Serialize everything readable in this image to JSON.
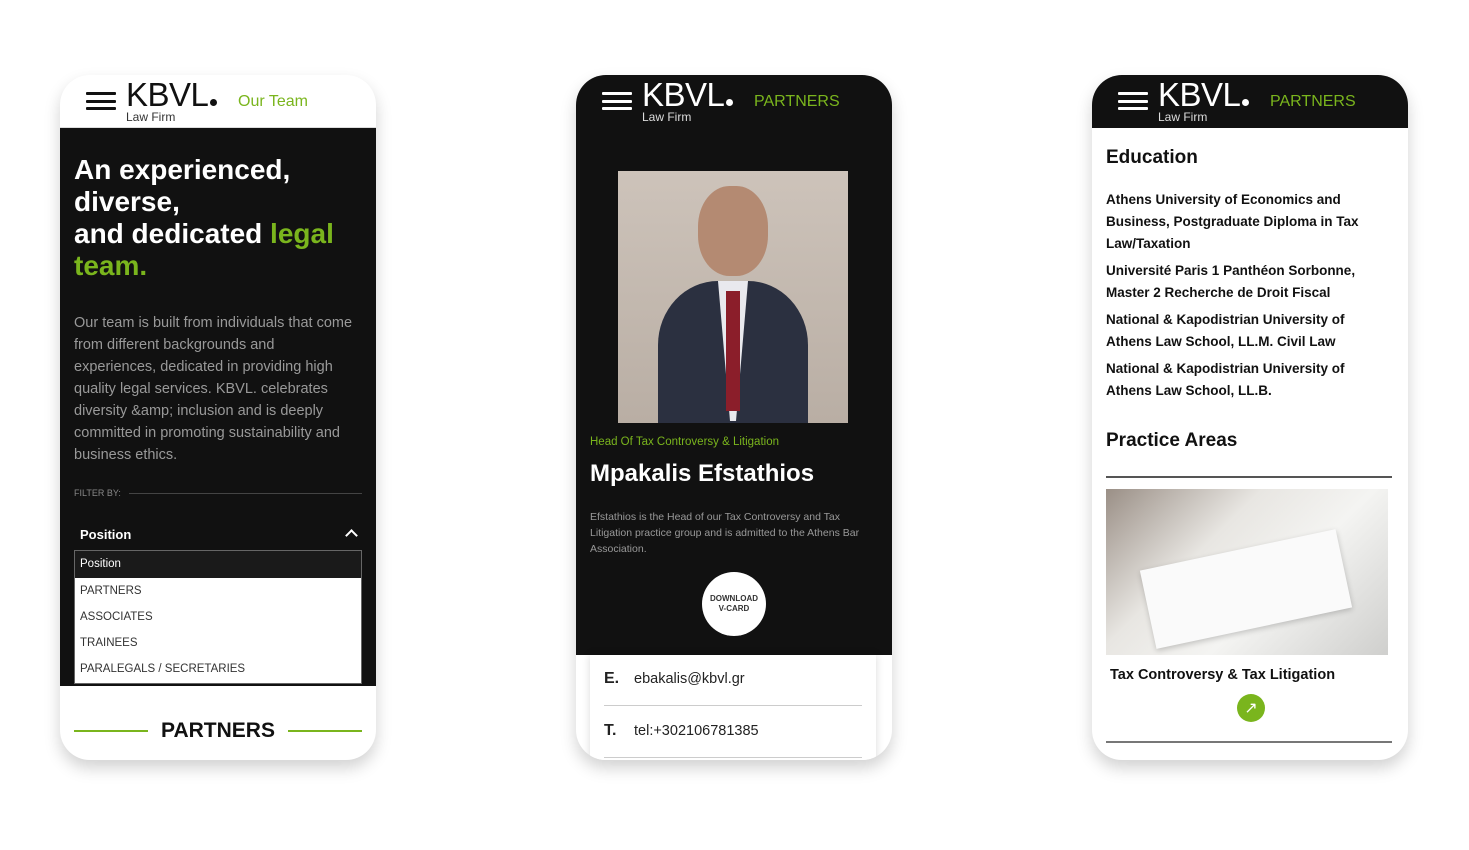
{
  "accent": "#7ab51d",
  "brand": {
    "logo": "KBVL",
    "sub": "Law Firm"
  },
  "phone1": {
    "nav_label": "Our Team",
    "headline_parts": [
      "An experienced,",
      "diverse,",
      "and dedicated ",
      "legal",
      "team."
    ],
    "intro": "Our team is built from individuals that come from different backgrounds and experiences, dedicated in providing high quality legal services. KBVL. celebrates diversity &amp; inclusion and is deeply committed in promoting sustainability and business ethics.",
    "filter_label": "FILTER BY:",
    "dropdown_title": "Position",
    "options": [
      "Position",
      "PARTNERS",
      "ASSOCIATES",
      "TRAINEES",
      "PARALEGALS / SECRETARIES"
    ],
    "section_title": "PARTNERS"
  },
  "phone2": {
    "nav_label": "PARTNERS",
    "role": "Head Of Tax Controversy & Litigation",
    "name": "Mpakalis Efstathios",
    "bio": "Efstathios is the Head of our Tax Controversy and Tax Litigation practice group and is admitted to the Athens Bar Association.",
    "vcard": [
      "DOWNLOAD",
      "V-CARD"
    ],
    "contacts": [
      {
        "key": "E.",
        "value": "ebakalis@kbvl.gr"
      },
      {
        "key": "T.",
        "value": "tel:+302106781385"
      }
    ]
  },
  "phone3": {
    "nav_label": "PARTNERS",
    "education_title": "Education",
    "education": [
      "Athens University of Economics and Business, Postgraduate Diploma in Tax Law/Taxation",
      "Université Paris 1 Panthéon Sorbonne, Master 2 Recherche de Droit Fiscal",
      "National & Kapodistrian University of Athens Law School, LL.M. Civil Law",
      "National & Kapodistrian University of Athens Law School, LL.B."
    ],
    "practice_title": "Practice Areas",
    "practice_item": "Tax Controversy & Tax Litigation"
  }
}
